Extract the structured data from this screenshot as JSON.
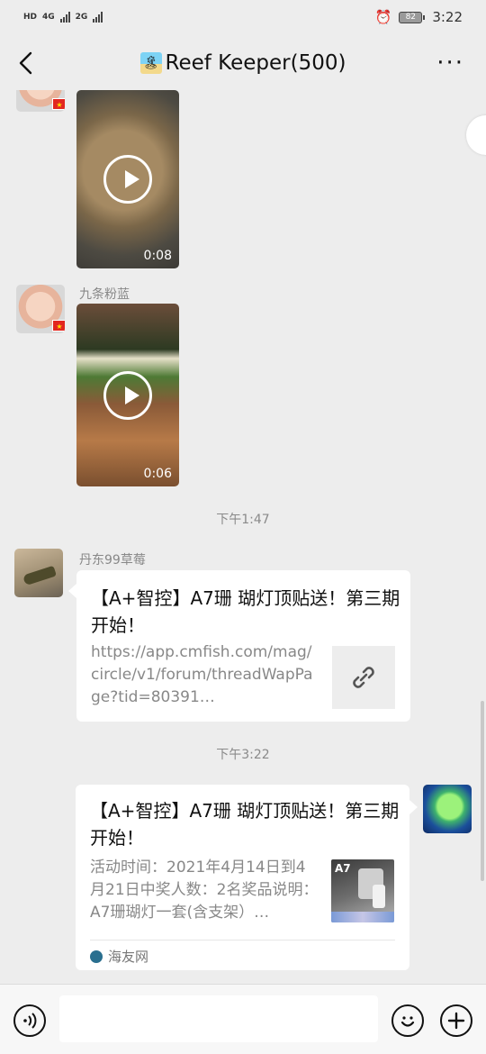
{
  "status_bar": {
    "network_left": "HD",
    "network_mid": "4G",
    "network_right": "2G",
    "battery": "82",
    "time": "3:22"
  },
  "header": {
    "title": "Reef Keeper(500)",
    "back_icon": "chevron-left-icon",
    "more_icon": "more-dots-icon"
  },
  "messages": {
    "video1": {
      "duration": "0:08"
    },
    "video2": {
      "sender": "九条粉蓝",
      "duration": "0:06"
    },
    "time1": "下午1:47",
    "link_card": {
      "sender": "丹东99草莓",
      "title": "【A+智控】A7珊 瑚灯顶贴送！第三期开始！",
      "url": "https://app.cmfish.com/mag/circle/v1/forum/threadWapPage?tid=80391…"
    },
    "time2": "下午3:22",
    "article_card": {
      "title": "【A+智控】A7珊 瑚灯顶贴送！第三期开始！",
      "desc": "活动时间：2021年4月14日到4月21日中奖人数：2名奖品说明：A7珊瑚灯一套(含支架）…",
      "thumb_label": "A7",
      "source": "海友网"
    }
  },
  "input_bar": {
    "placeholder": "",
    "voice_icon": "voice-icon",
    "emoji_icon": "emoji-icon",
    "plus_icon": "plus-icon"
  }
}
